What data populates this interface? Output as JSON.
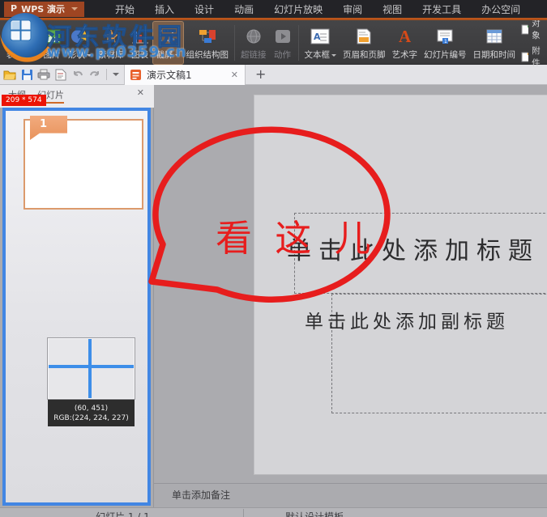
{
  "titlebar": {
    "app_letter": "P",
    "app_name": "WPS 演示",
    "menus": [
      "开始",
      "插入",
      "设计",
      "动画",
      "幻灯片放映",
      "审阅",
      "视图",
      "开发工具",
      "办公空间"
    ]
  },
  "ribbon": {
    "items": [
      {
        "label": "表格"
      },
      {
        "label": "图片"
      },
      {
        "label": "形状"
      },
      {
        "label": "素材库"
      },
      {
        "label": "图表"
      },
      {
        "label": "截屏"
      },
      {
        "label": "组织结构图"
      },
      {
        "label": "超链接"
      },
      {
        "label": "动作"
      },
      {
        "label": "文本框"
      },
      {
        "label": "页眉和页脚"
      },
      {
        "label": "艺术字"
      },
      {
        "label": "幻灯片编号"
      },
      {
        "label": "日期和时间"
      },
      {
        "label": "对象"
      },
      {
        "label": "附件"
      }
    ]
  },
  "tabrow": {
    "doc_tab_label": "演示文稿1",
    "close_glyph": "✕",
    "new_tab_glyph": "+"
  },
  "sidebar": {
    "tab_outline": "大纲",
    "tab_slides": "幻灯片",
    "close_glyph": "✕",
    "size_badge": "209 * 574",
    "slide_number": "1",
    "magnifier": {
      "coords": "(60, 451)",
      "rgb": "RGB:(224, 224, 227)"
    }
  },
  "slide": {
    "title_placeholder": "单击此处添加标题",
    "subtitle_placeholder": "单击此处添加副标题"
  },
  "annotation": {
    "text": "看 这 儿"
  },
  "notes": {
    "placeholder": "单击添加备注"
  },
  "statusbar": {
    "slide_indicator": "幻灯片 1 / 1",
    "template_name": "默认设计模板"
  },
  "watermark": {
    "site_name": "河东软件园",
    "site_url": "www.pc0359.cn"
  },
  "colors": {
    "accent_orange": "#c2591d",
    "annotation_red": "#e71d1d",
    "selection_blue": "#4286e3",
    "crosshair_blue": "#3d8ee9",
    "badge_red": "#ec1405"
  }
}
